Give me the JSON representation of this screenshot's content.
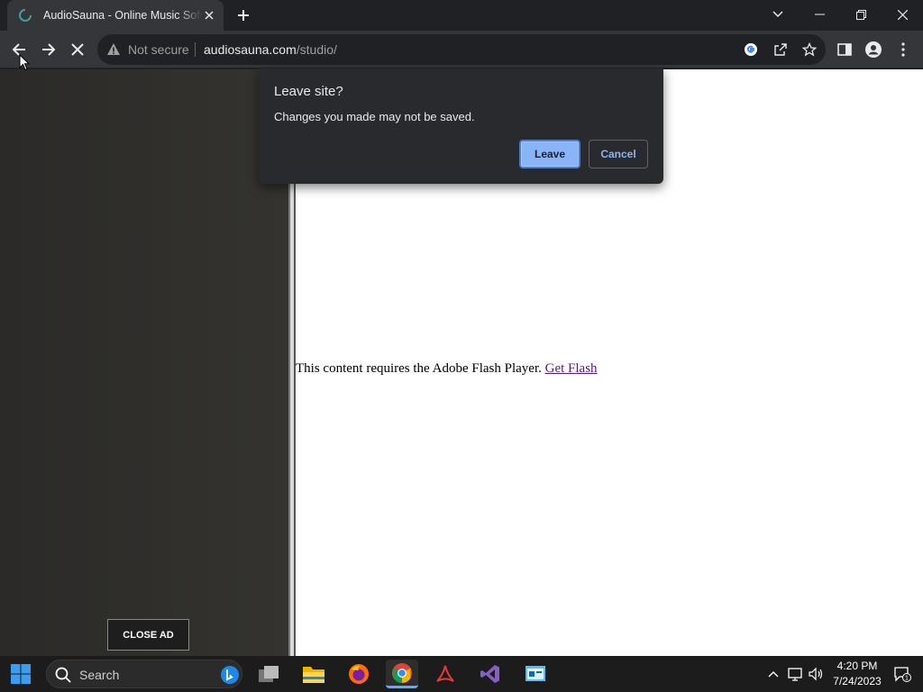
{
  "browser": {
    "tab_title": "AudioSauna - Online Music Software",
    "security_label": "Not secure",
    "url_host": "audiosauna.com",
    "url_path": "/studio/"
  },
  "page": {
    "flash_message": "This content requires the Adobe Flash Player.",
    "flash_link": "Get Flash",
    "close_ad_label": "CLOSE AD"
  },
  "dialog": {
    "title": "Leave site?",
    "body": "Changes you made may not be saved.",
    "leave_label": "Leave",
    "cancel_label": "Cancel"
  },
  "taskbar": {
    "search_placeholder": "Search",
    "time": "4:20 PM",
    "date": "7/24/2023",
    "notification_count": "1",
    "apps": [
      "task-view",
      "file-explorer",
      "firefox",
      "chrome",
      "acrobat",
      "visual-studio",
      "control-panel"
    ]
  },
  "colors": {
    "accent": "#8ab4f8",
    "dialog_bg": "#292a2d",
    "chrome_toolbar": "#35363a"
  }
}
